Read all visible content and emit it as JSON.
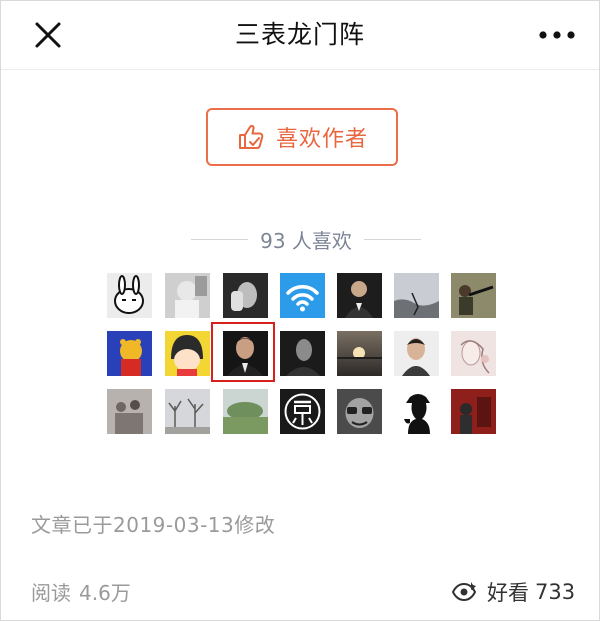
{
  "navbar": {
    "title": "三表龙门阵",
    "close_icon": "close-icon",
    "more_icon": "more-dots-icon"
  },
  "like_button": {
    "label": "喜欢作者",
    "icon": "thumbs-up-icon",
    "accent": "#e8673f"
  },
  "likes": {
    "count_text": "93 人喜欢"
  },
  "avatars": [
    {
      "name": "avatar-rabbit-cartoon"
    },
    {
      "name": "avatar-baby-photo"
    },
    {
      "name": "avatar-man-hand-face"
    },
    {
      "name": "avatar-wifi-logo"
    },
    {
      "name": "avatar-man-suit"
    },
    {
      "name": "avatar-coastline"
    },
    {
      "name": "avatar-man-rifle"
    },
    {
      "name": "avatar-winnie-pooh"
    },
    {
      "name": "avatar-maruko"
    },
    {
      "name": "avatar-man-portrait-highlighted"
    },
    {
      "name": "avatar-man-dark"
    },
    {
      "name": "avatar-sunset"
    },
    {
      "name": "avatar-young-man"
    },
    {
      "name": "avatar-sketch-girl"
    },
    {
      "name": "avatar-group-photo"
    },
    {
      "name": "avatar-trees"
    },
    {
      "name": "avatar-landscape"
    },
    {
      "name": "avatar-jing-logo"
    },
    {
      "name": "avatar-cartoon-face"
    },
    {
      "name": "avatar-silhouette-pipe"
    },
    {
      "name": "avatar-red-room"
    }
  ],
  "footer": {
    "modified_text": "文章已于2019-03-13修改",
    "reads_label": "阅读",
    "reads_count": "4.6万",
    "wow_label": "好看",
    "wow_count": "733",
    "wow_icon": "wow-icon"
  }
}
